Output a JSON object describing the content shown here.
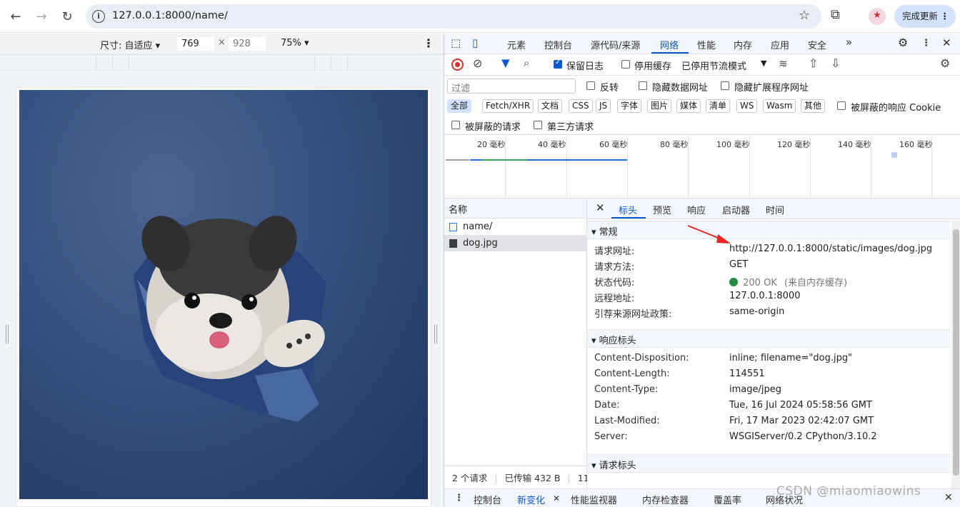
{
  "browser": {
    "url": "127.0.0.1:8000/name/",
    "update_label": "完成更新"
  },
  "device_toolbar": {
    "dimensions_label": "尺寸: 自适应 ▾",
    "width": "769",
    "height": "928",
    "zoom": "75% ▾"
  },
  "devtools": {
    "tabs": [
      "元素",
      "控制台",
      "源代码/来源",
      "网络",
      "性能",
      "内存",
      "应用",
      "安全"
    ],
    "active_tab": "网络",
    "toolbar": {
      "preserve_log": "保留日志",
      "disable_cache": "停用缓存",
      "throttle": "已停用节流模式"
    },
    "filter": {
      "placeholder": "过滤",
      "invert": "反转",
      "hide_data_urls": "隐藏数据网址",
      "hide_ext_urls": "隐藏扩展程序网址",
      "types": [
        "全部",
        "Fetch/XHR",
        "文档",
        "CSS",
        "JS",
        "字体",
        "图片",
        "媒体",
        "清单",
        "WS",
        "Wasm",
        "其他"
      ],
      "blocked_cookies": "被屏蔽的响应 Cookie",
      "blocked_requests": "被屏蔽的请求",
      "third_party": "第三方请求"
    },
    "overview_labels": [
      "20 毫秒",
      "40 毫秒",
      "60 毫秒",
      "80 毫秒",
      "100 毫秒",
      "120 毫秒",
      "140 毫秒",
      "160 毫秒"
    ],
    "request_list": {
      "header": "名称",
      "items": [
        {
          "name": "name/"
        },
        {
          "name": "dog.jpg"
        }
      ],
      "status": {
        "count": "2 个请求",
        "transferred": "已传输 432 B",
        "extra": "11"
      }
    },
    "details": {
      "tabs": [
        "标头",
        "预览",
        "响应",
        "启动器",
        "时间"
      ],
      "active_tab": "标头",
      "general": {
        "title": "▾ 常规",
        "rows": [
          {
            "key": "请求网址:",
            "value": "http://127.0.0.1:8000/static/images/dog.jpg"
          },
          {
            "key": "请求方法:",
            "value": "GET"
          },
          {
            "key": "状态代码:",
            "value": "200 OK",
            "note": "(来自内存缓存)"
          },
          {
            "key": "远程地址:",
            "value": "127.0.0.1:8000"
          },
          {
            "key": "引荐来源网址政策:",
            "value": "same-origin"
          }
        ]
      },
      "response_headers": {
        "title": "▾ 响应标头",
        "rows": [
          {
            "key": "Content-Disposition:",
            "value": "inline; filename=\"dog.jpg\""
          },
          {
            "key": "Content-Length:",
            "value": "114551"
          },
          {
            "key": "Content-Type:",
            "value": "image/jpeg"
          },
          {
            "key": "Date:",
            "value": "Tue, 16 Jul 2024 05:58:56 GMT"
          },
          {
            "key": "Last-Modified:",
            "value": "Fri, 17 Mar 2023 02:42:07 GMT"
          },
          {
            "key": "Server:",
            "value": "WSGIServer/0.2 CPython/3.10.2"
          }
        ]
      },
      "request_headers": {
        "title": "▾ 请求标头"
      }
    },
    "drawer_tabs": [
      "控制台",
      "新变化",
      "性能监视器",
      "内存检查器",
      "覆盖率",
      "网络状况"
    ],
    "drawer_active": "新变化"
  },
  "watermark": "CSDN @miaomiaowins",
  "colors": {
    "accent": "#0b57d0",
    "status_ok": "#1e8e3e",
    "record_red": "#d93025",
    "annotation_arrow": "#e8251f"
  }
}
